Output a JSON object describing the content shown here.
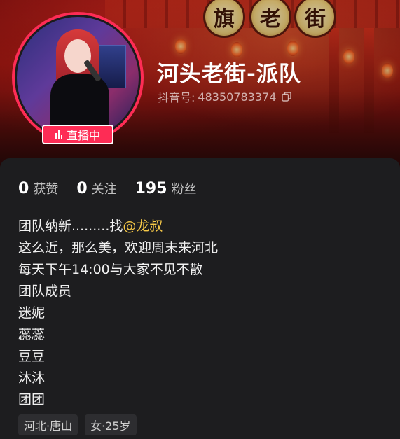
{
  "banner": {
    "signboard_chars": [
      "旗",
      "老",
      "街"
    ]
  },
  "profile": {
    "name": "河头老街-派队",
    "uid_label": "抖音号:",
    "uid_value": "48350783374",
    "live_badge": "直播中",
    "accent_color": "#fe2c55"
  },
  "stats": [
    {
      "num": "0",
      "label": "获赞"
    },
    {
      "num": "0",
      "label": "关注"
    },
    {
      "num": "195",
      "label": "粉丝"
    }
  ],
  "bio": {
    "line1_prefix": "团队纳新.........找",
    "line1_mention": "@龙叔",
    "lines": [
      "这么近，那么美，欢迎周末来河北",
      "每天下午14:00与大家不见不散",
      "团队成员",
      "迷妮",
      "蕊蕊",
      "豆豆",
      "沐沐",
      "团团"
    ]
  },
  "tags": [
    "河北·唐山",
    "女·25岁"
  ],
  "icons": {
    "copy": "copy-icon",
    "live": "live-bars-icon"
  }
}
